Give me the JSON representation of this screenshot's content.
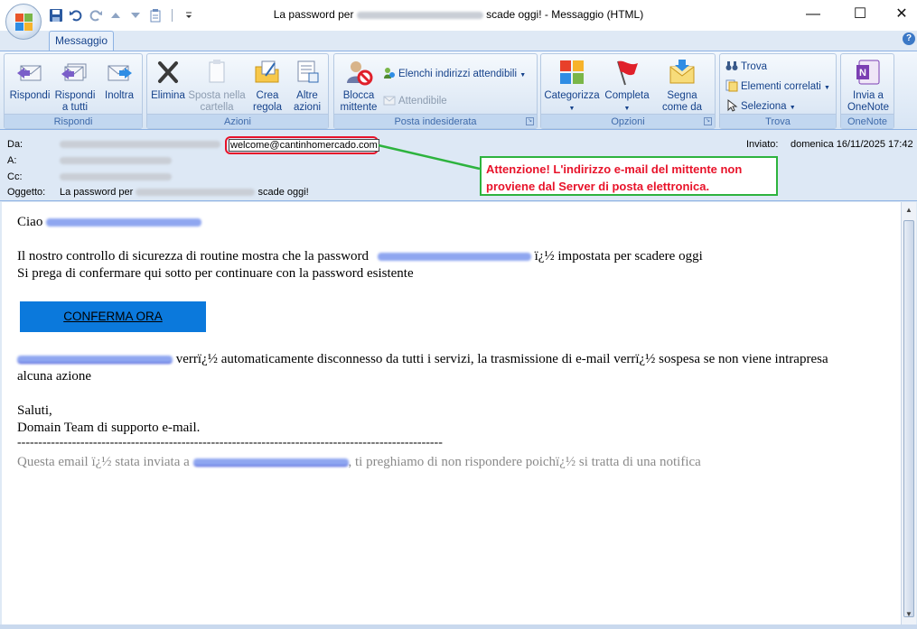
{
  "window": {
    "title_prefix": "La password per",
    "title_suffix": "scade oggi! - Messaggio (HTML)",
    "minimize": "—",
    "maximize": "☐",
    "close": "✕"
  },
  "quick_access": [
    "save-icon",
    "undo-icon",
    "redo-icon",
    "up-icon",
    "down-icon",
    "clipboard-icon",
    "customize-icon"
  ],
  "tabs": {
    "active": "Messaggio",
    "help": "?"
  },
  "ribbon": {
    "groups": {
      "rispondi": "Rispondi",
      "azioni": "Azioni",
      "posta": "Posta indesiderata",
      "opzioni": "Opzioni",
      "trova": "Trova",
      "onenote": "OneNote"
    },
    "buttons": {
      "rispondi": "Rispondi",
      "rispondi_tutti": "Rispondi a tutti",
      "inoltra": "Inoltra",
      "elimina": "Elimina",
      "sposta": "Sposta nella cartella",
      "crea_regola": "Crea regola",
      "altre_azioni": "Altre azioni",
      "blocca": "Blocca mittente",
      "elenchi": "Elenchi indirizzi attendibili",
      "attendibile": "Attendibile",
      "categorizza": "Categorizza",
      "completa": "Completa",
      "segna": "Segna come da leggere",
      "trova": "Trova",
      "elementi": "Elementi correlati",
      "seleziona": "Seleziona",
      "invia_onenote": "Invia a OneNote"
    }
  },
  "header": {
    "from_label": "Da:",
    "to_label": "A:",
    "cc_label": "Cc:",
    "subject_label": "Oggetto:",
    "sender_email": "welcome@cantinhomercado.com",
    "sent_label": "Inviato:",
    "sent_value": "domenica 16/11/2025 17:42",
    "subject_prefix": "La password per",
    "subject_suffix": "scade oggi!",
    "warning": "Attenzione! L'indirizzo e-mail del mittente non proviene dal Server di posta elettronica."
  },
  "body": {
    "greeting": "Ciao",
    "line1_prefix": "Il nostro controllo di sicurezza di routine mostra che la password",
    "line1_suffix": "ï¿½ impostata per scadere oggi",
    "line2": "Si prega di confermare qui sotto per continuare con la password esistente",
    "button": "CONFERMA ORA",
    "line3_suffix": "verrï¿½ automaticamente disconnesso da tutti i servizi, la trasmissione di e-mail verrï¿½ sospesa se non viene intrapresa",
    "line4": "alcuna azione",
    "closing": "Saluti,",
    "signature": "Domain Team di supporto e-mail.",
    "separator": "-----------------------------------------------------------------------------------------------------",
    "footer_prefix": "Questa email ï¿½ stata inviata a",
    "footer_suffix": ", ti preghiamo di non rispondere poichï¿½ si tratta di una notifica"
  },
  "colors": {
    "alert_red": "#e8132a",
    "annotation_green": "#2db33e",
    "button_blue": "#0b79dc",
    "ribbon_text": "#15428b"
  }
}
